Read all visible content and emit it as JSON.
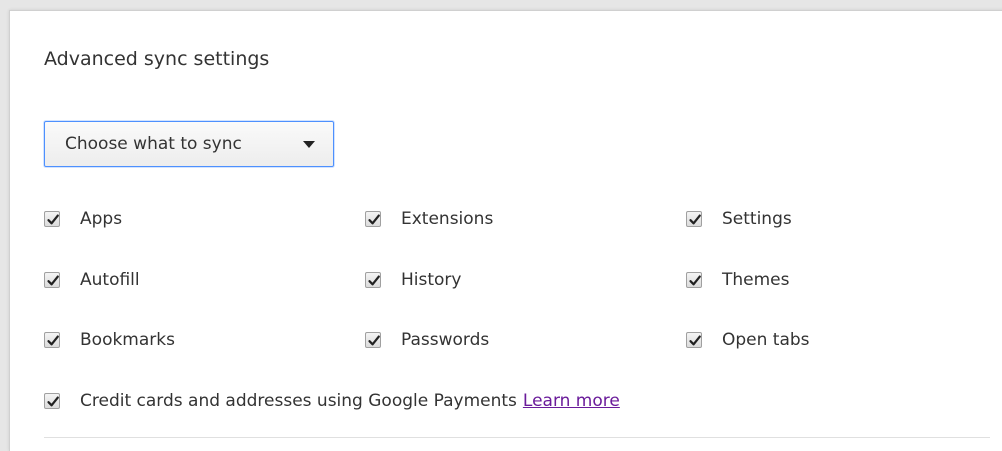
{
  "dialog": {
    "title": "Advanced sync settings",
    "sync_mode_select": {
      "selected": "Choose what to sync"
    },
    "options": [
      {
        "label": "Apps",
        "checked": true
      },
      {
        "label": "Extensions",
        "checked": true
      },
      {
        "label": "Settings",
        "checked": true
      },
      {
        "label": "Autofill",
        "checked": true
      },
      {
        "label": "History",
        "checked": true
      },
      {
        "label": "Themes",
        "checked": true
      },
      {
        "label": "Bookmarks",
        "checked": true
      },
      {
        "label": "Passwords",
        "checked": true
      },
      {
        "label": "Open tabs",
        "checked": true
      }
    ],
    "payments_option": {
      "label": "Credit cards and addresses using Google Payments",
      "checked": true,
      "link_text": "Learn more"
    }
  },
  "colors": {
    "focus_border": "#4d90fe",
    "link_visited": "#6a1b9a",
    "text": "#333333"
  }
}
